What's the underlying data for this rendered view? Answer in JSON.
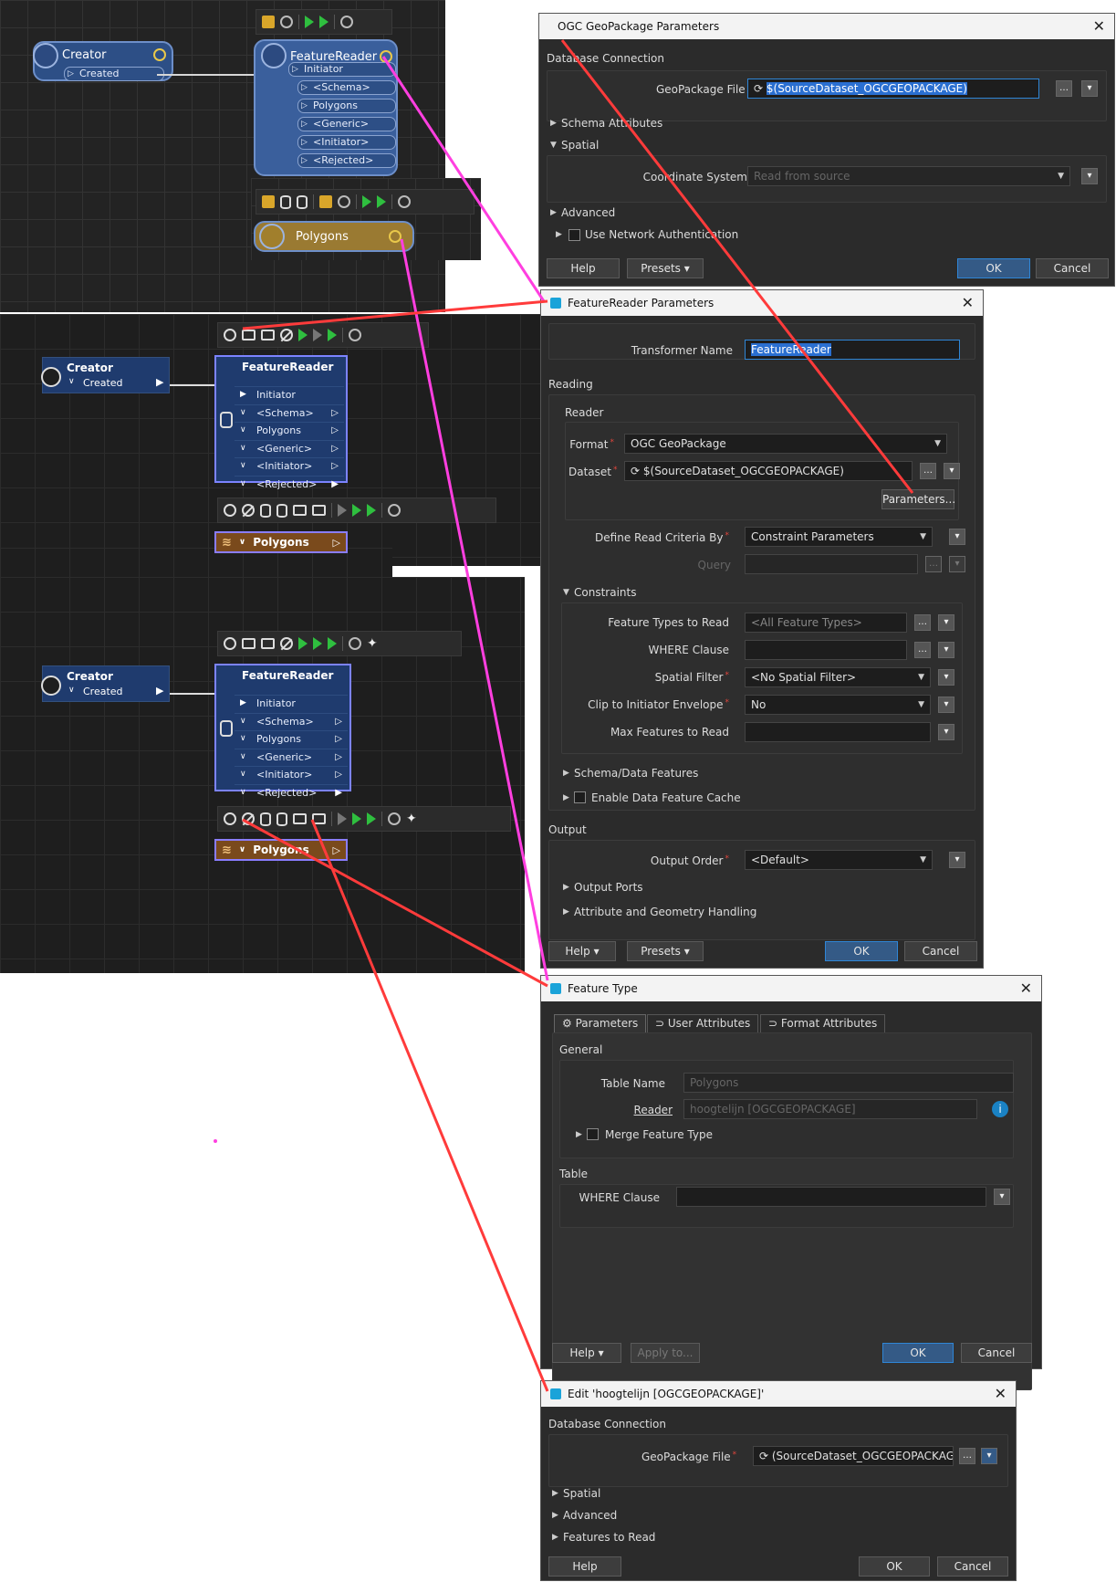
{
  "canvas1": {
    "creator": {
      "title": "Creator",
      "port": "Created"
    },
    "reader": {
      "title": "FeatureReader",
      "ports": [
        "Initiator",
        "<Schema>",
        "Polygons",
        "<Generic>",
        "<Initiator>",
        "<Rejected>"
      ]
    },
    "feature": {
      "title": "Polygons"
    }
  },
  "canvas2": {
    "creator": {
      "title": "Creator",
      "port": "Created"
    },
    "reader": {
      "title": "FeatureReader",
      "ports": [
        "Initiator",
        "<Schema>",
        "Polygons",
        "<Generic>",
        "<Initiator>",
        "<Rejected>"
      ]
    },
    "feature": {
      "title": "Polygons"
    }
  },
  "canvas3": {
    "creator": {
      "title": "Creator",
      "port": "Created"
    },
    "reader": {
      "title": "FeatureReader",
      "ports": [
        "Initiator",
        "<Schema>",
        "Polygons",
        "<Generic>",
        "<Initiator>",
        "<Rejected>"
      ]
    },
    "feature": {
      "title": "Polygons"
    }
  },
  "dlg_gpkg": {
    "title": "OGC GeoPackage Parameters",
    "section_db": "Database Connection",
    "file_label": "GeoPackage File",
    "file_value": "$(SourceDataset_OGCGEOPACKAGE)",
    "schema": "Schema Attributes",
    "spatial": "Spatial",
    "coord_label": "Coordinate System",
    "coord_value": "Read from source",
    "advanced": "Advanced",
    "netauth": "Use Network Authentication",
    "help": "Help",
    "presets": "Presets",
    "ok": "OK",
    "cancel": "Cancel"
  },
  "dlg_fr": {
    "title": "FeatureReader Parameters",
    "tname_label": "Transformer Name",
    "tname_value": "FeatureReader",
    "reading": "Reading",
    "reader": "Reader",
    "format_label": "Format",
    "format_value": "OGC GeoPackage",
    "dataset_label": "Dataset",
    "dataset_value": "$(SourceDataset_OGCGEOPACKAGE)",
    "params_btn": "Parameters...",
    "criteria_label": "Define Read Criteria By",
    "criteria_value": "Constraint Parameters",
    "query_label": "Query",
    "constraints": "Constraints",
    "ftypes_label": "Feature Types to Read",
    "ftypes_value": "<All Feature Types>",
    "where_label": "WHERE Clause",
    "spatial_label": "Spatial Filter",
    "spatial_value": "<No Spatial Filter>",
    "clip_label": "Clip to Initiator Envelope",
    "clip_value": "No",
    "max_label": "Max Features to Read",
    "schema_data": "Schema/Data Features",
    "cache": "Enable Data Feature Cache",
    "output": "Output",
    "order_label": "Output Order",
    "order_value": "<Default>",
    "ports": "Output Ports",
    "attr_geom": "Attribute and Geometry Handling",
    "help": "Help",
    "presets": "Presets",
    "ok": "OK",
    "cancel": "Cancel"
  },
  "dlg_ft": {
    "title": "Feature Type",
    "tabs": [
      "Parameters",
      "User Attributes",
      "Format Attributes"
    ],
    "general": "General",
    "table_label": "Table Name",
    "table_value": "Polygons",
    "reader_label": "Reader",
    "reader_value": "hoogtelijn [OGCGEOPACKAGE]",
    "merge": "Merge Feature Type",
    "table_sec": "Table",
    "where_label": "WHERE Clause",
    "help": "Help",
    "apply": "Apply to...",
    "ok": "OK",
    "cancel": "Cancel"
  },
  "dlg_edit": {
    "title": "Edit 'hoogtelijn [OGCGEOPACKAGE]'",
    "section_db": "Database Connection",
    "file_label": "GeoPackage File",
    "file_value": "(SourceDataset_OGCGEOPACKAGE)",
    "spatial": "Spatial",
    "advanced": "Advanced",
    "features": "Features to Read",
    "help": "Help",
    "ok": "OK",
    "cancel": "Cancel"
  },
  "colors": {
    "magenta_line": "#ff3fe0",
    "red_line": "#ff3b3b",
    "accent": "#2f86d6"
  }
}
